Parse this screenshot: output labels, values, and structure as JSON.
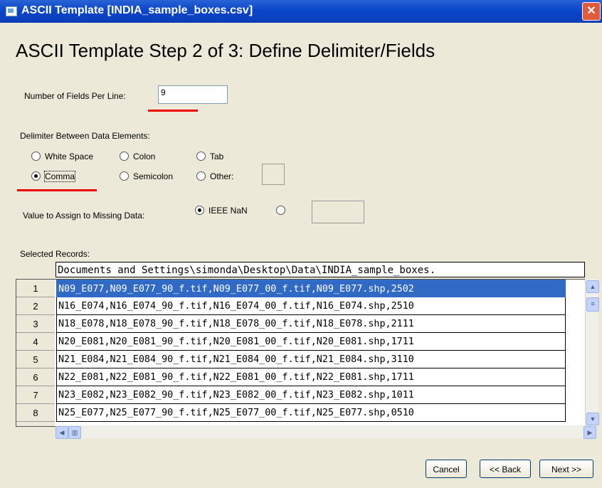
{
  "window": {
    "title": "ASCII Template [INDIA_sample_boxes.csv]",
    "close_glyph": "✕"
  },
  "heading": "ASCII Template Step 2 of 3: Define Delimiter/Fields",
  "fields_per_line": {
    "label": "Number of Fields Per Line:",
    "value": "9"
  },
  "delimiter": {
    "label": "Delimiter Between Data Elements:",
    "options": [
      "White Space",
      "Colon",
      "Tab",
      "Comma",
      "Semicolon",
      "Other:"
    ],
    "selected": "Comma"
  },
  "missing": {
    "label": "Value to Assign to Missing Data:",
    "option1": "IEEE NaN",
    "selected": "IEEE NaN"
  },
  "records": {
    "label": "Selected Records:",
    "path": "Documents and Settings\\simonda\\Desktop\\Data\\INDIA_sample_boxes.",
    "rows": [
      {
        "num": "1",
        "text": "N09_E077,N09_E077_90_f.tif,N09_E077_00_f.tif,N09_E077.shp,2502"
      },
      {
        "num": "2",
        "text": "N16_E074,N16_E074_90_f.tif,N16_E074_00_f.tif,N16_E074.shp,2510"
      },
      {
        "num": "3",
        "text": "N18_E078,N18_E078_90_f.tif,N18_E078_00_f.tif,N18_E078.shp,2111"
      },
      {
        "num": "4",
        "text": "N20_E081,N20_E081_90_f.tif,N20_E081_00_f.tif,N20_E081.shp,1711"
      },
      {
        "num": "5",
        "text": "N21_E084,N21_E084_90_f.tif,N21_E084_00_f.tif,N21_E084.shp,3110"
      },
      {
        "num": "6",
        "text": "N22_E081,N22_E081_90_f.tif,N22_E081_00_f.tif,N22_E081.shp,1711"
      },
      {
        "num": "7",
        "text": "N23_E082,N23_E082_90_f.tif,N23_E082_00_f.tif,N23_E082.shp,1011"
      },
      {
        "num": "8",
        "text": "N25_E077,N25_E077_90_f.tif,N25_E077_00_f.tif,N25_E077.shp,0510"
      }
    ]
  },
  "buttons": {
    "cancel": "Cancel",
    "back": "<< Back",
    "next": "Next >>"
  },
  "colors": {
    "selection": "#316ac5",
    "annotation_red": "#ee0000",
    "titlebar": "#0a47c9"
  }
}
